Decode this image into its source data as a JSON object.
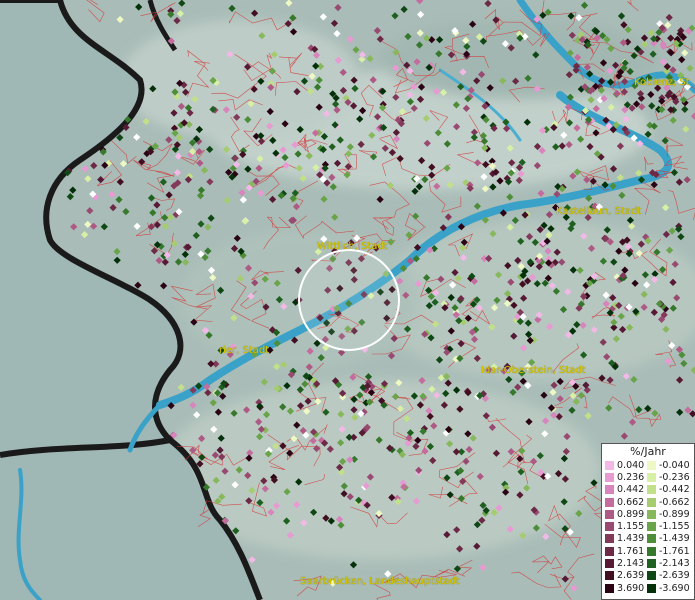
{
  "map": {
    "cities": [
      {
        "name": "Koblenz, St"
      },
      {
        "name": "Kastellaun, Stadt"
      },
      {
        "name": "Wittlich, Stadt"
      },
      {
        "name": "rier, Stadt"
      },
      {
        "name": "Idar-Oberstein, Stadt"
      },
      {
        "name": "Saarbrücken, Landeshauptstadt"
      }
    ]
  },
  "legend": {
    "title": "%/Jahr",
    "positive": [
      {
        "label": "0.040",
        "color": "#f2b8e6"
      },
      {
        "label": "0.236",
        "color": "#e89ad2"
      },
      {
        "label": "0.442",
        "color": "#d884bd"
      },
      {
        "label": "0.662",
        "color": "#c46c9e"
      },
      {
        "label": "0.899",
        "color": "#ae5a84"
      },
      {
        "label": "1.155",
        "color": "#984a70"
      },
      {
        "label": "1.439",
        "color": "#833a5a"
      },
      {
        "label": "1.761",
        "color": "#6c2a46"
      },
      {
        "label": "2.143",
        "color": "#561a34"
      },
      {
        "label": "2.639",
        "color": "#420e22"
      },
      {
        "label": "3.690",
        "color": "#2a0414"
      }
    ],
    "negative": [
      {
        "label": "-0.040",
        "color": "#eef8c4"
      },
      {
        "label": "-0.236",
        "color": "#d8efa6"
      },
      {
        "label": "-0.442",
        "color": "#c2e08a"
      },
      {
        "label": "-0.662",
        "color": "#a6cc70"
      },
      {
        "label": "-0.899",
        "color": "#88b85c"
      },
      {
        "label": "-1.155",
        "color": "#6aa44a"
      },
      {
        "label": "-1.439",
        "color": "#4e8e3a"
      },
      {
        "label": "-1.761",
        "color": "#36782c"
      },
      {
        "label": "-2.143",
        "color": "#1f6020"
      },
      {
        "label": "-2.639",
        "color": "#0f4814"
      },
      {
        "label": "-3.690",
        "color": "#04300a"
      }
    ]
  },
  "colors": {
    "water": "#3aa2c8",
    "border": "#1a1a1a",
    "admin_lines": "#d33a3a",
    "highlight_circle": "#ffffff",
    "white_point": "#ffffff"
  }
}
